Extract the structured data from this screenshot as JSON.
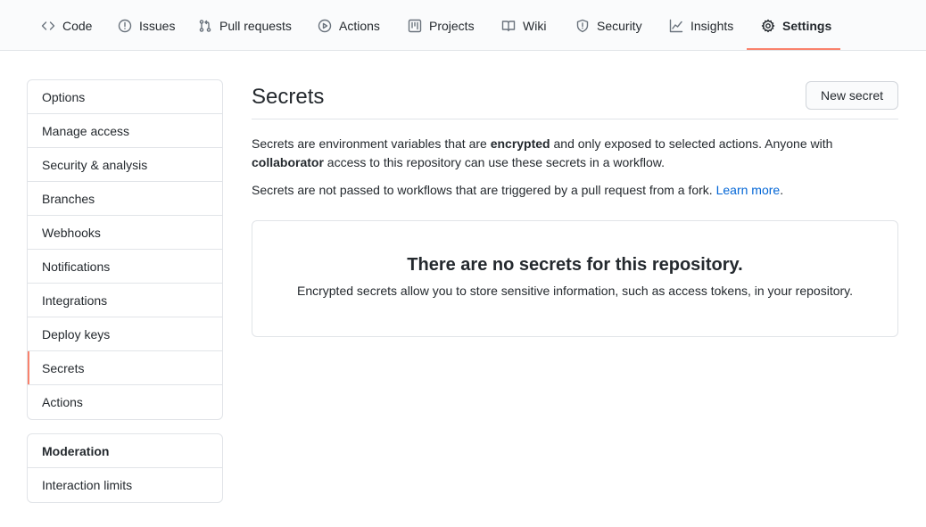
{
  "tabs": [
    {
      "label": "Code",
      "icon": "code-icon"
    },
    {
      "label": "Issues",
      "icon": "issue-opened-icon"
    },
    {
      "label": "Pull requests",
      "icon": "git-pull-request-icon"
    },
    {
      "label": "Actions",
      "icon": "play-icon"
    },
    {
      "label": "Projects",
      "icon": "project-icon"
    },
    {
      "label": "Wiki",
      "icon": "book-icon"
    },
    {
      "label": "Security",
      "icon": "shield-icon"
    },
    {
      "label": "Insights",
      "icon": "graph-icon"
    },
    {
      "label": "Settings",
      "icon": "gear-icon",
      "selected": true
    }
  ],
  "sidebar": {
    "items": [
      {
        "label": "Options"
      },
      {
        "label": "Manage access"
      },
      {
        "label": "Security & analysis"
      },
      {
        "label": "Branches"
      },
      {
        "label": "Webhooks"
      },
      {
        "label": "Notifications"
      },
      {
        "label": "Integrations"
      },
      {
        "label": "Deploy keys"
      },
      {
        "label": "Secrets",
        "selected": true
      },
      {
        "label": "Actions"
      }
    ],
    "moderation": {
      "heading": "Moderation",
      "items": [
        {
          "label": "Interaction limits"
        }
      ]
    }
  },
  "main": {
    "title": "Secrets",
    "new_button": "New secret",
    "p1": {
      "a": "Secrets are environment variables that are ",
      "b": "encrypted",
      "c": " and only exposed to selected actions. Anyone with ",
      "d": "collaborator",
      "e": " access to this repository can use these secrets in a workflow."
    },
    "p2": {
      "text": "Secrets are not passed to workflows that are triggered by a pull request from a fork. ",
      "link": "Learn more",
      "end": "."
    },
    "blankslate": {
      "title": "There are no secrets for this repository.",
      "description": "Encrypted secrets allow you to store sensitive information, such as access tokens, in your repository."
    }
  },
  "colors": {
    "accent": "#f9826c",
    "link": "#0366d6",
    "border": "#e1e4e8"
  }
}
